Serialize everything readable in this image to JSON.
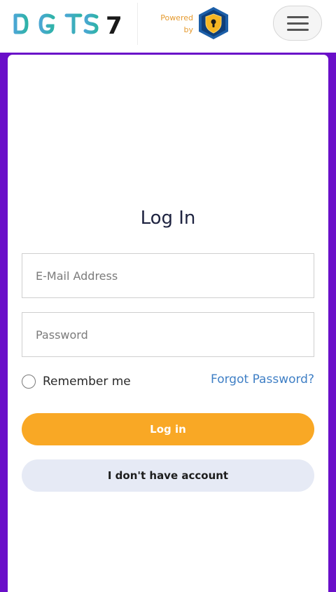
{
  "header": {
    "logo_text": "DIGITS 7",
    "powered_line1": "Powered",
    "powered_line2": "by",
    "shield_icon": "shield-lock-icon",
    "menu_icon": "hamburger-menu-icon"
  },
  "login": {
    "title": "Log In",
    "email_placeholder": "E-Mail Address",
    "email_value": "",
    "password_placeholder": "Password",
    "password_value": "",
    "remember_label": "Remember me",
    "remember_checked": false,
    "forgot_label": "Forgot Password?",
    "login_button": "Log in",
    "no_account_button": "I don't have account"
  },
  "colors": {
    "background": "#6a0fc9",
    "primary_button": "#f9a825",
    "secondary_button": "#e6eaf5",
    "link": "#3f7fc5",
    "logo_gradient_start": "#3ba9c9",
    "logo_digit": "#1a1a1a",
    "powered_text": "#e59a2f"
  }
}
